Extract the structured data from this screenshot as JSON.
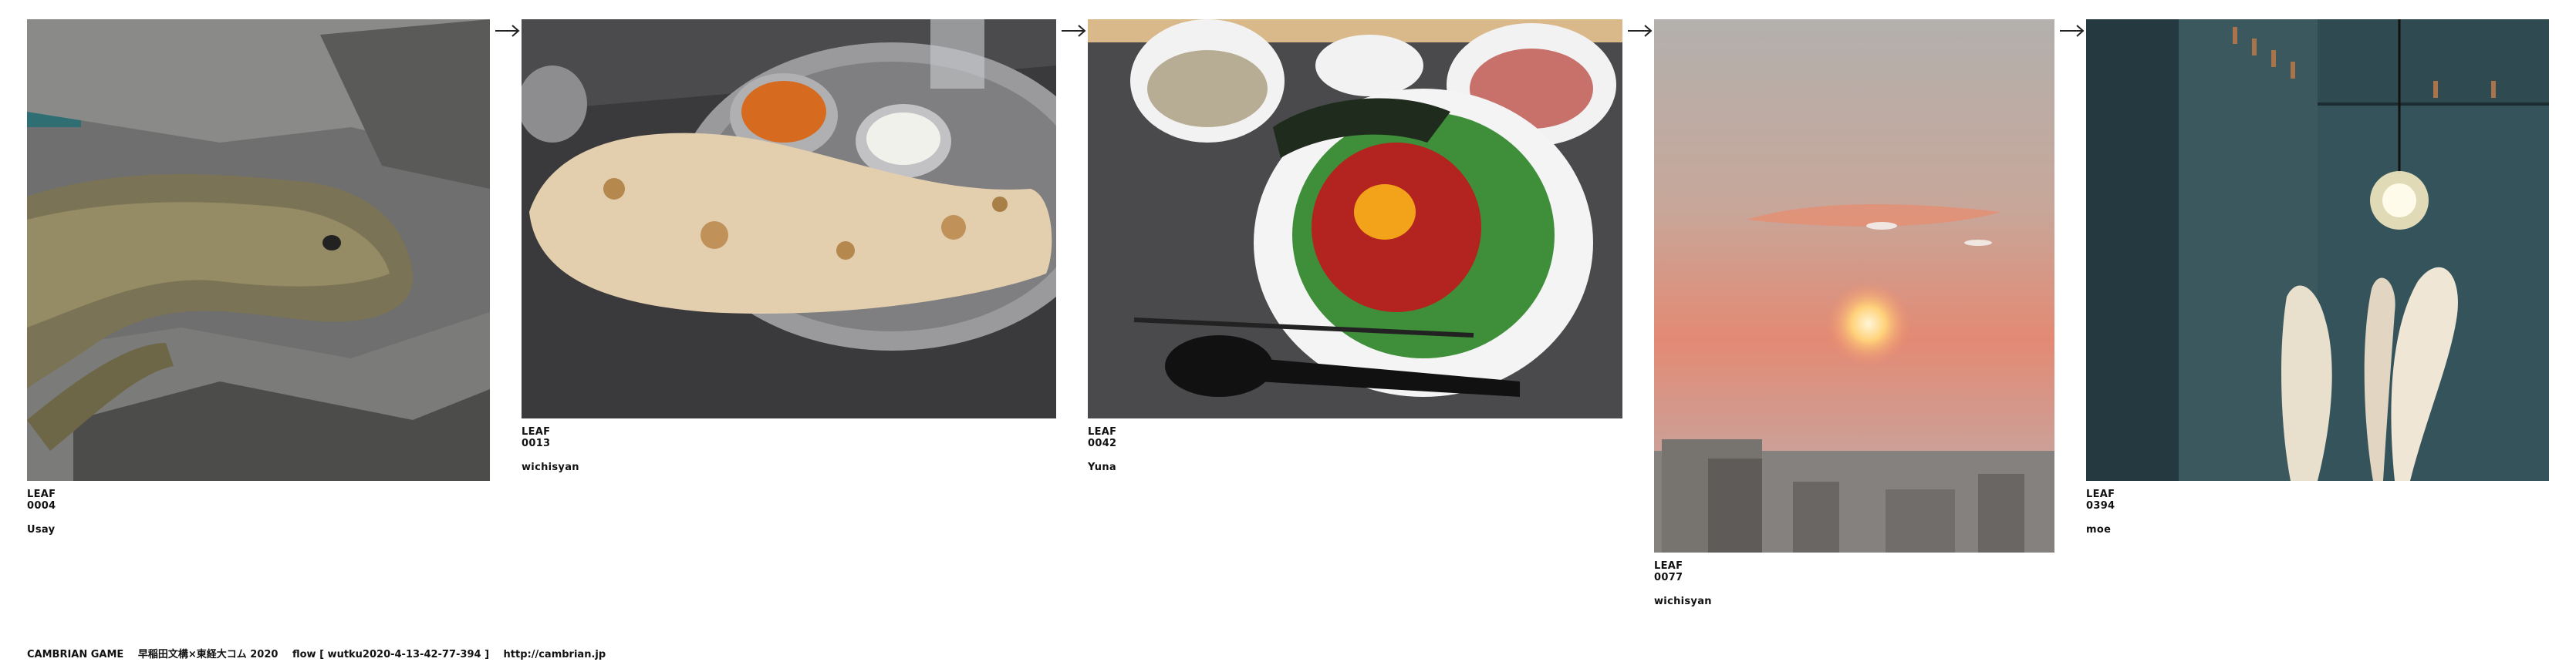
{
  "leaves": [
    {
      "code": "LEAF 0004",
      "author": "Usay",
      "image": "lizard on rocks"
    },
    {
      "code": "LEAF 0013",
      "author": "wichisyan",
      "image": "naan with curry plate"
    },
    {
      "code": "LEAF 0042",
      "author": "Yuna",
      "image": "yukhoe rice bowl tray"
    },
    {
      "code": "LEAF 0077",
      "author": "wichisyan",
      "image": "sunset over city"
    },
    {
      "code": "LEAF 0394",
      "author": "moe",
      "image": "pampas grass under lamp"
    }
  ],
  "footer": {
    "title": "CAMBRIAN GAME",
    "subtitle": "早稲田文構×東経大コム 2020",
    "flow": "flow [ wutku2020-4-13-42-77-394 ]",
    "url": "http://cambrian.jp"
  },
  "colors": {
    "text": "#111111",
    "background": "#ffffff"
  },
  "icons": {
    "connector": "right-arrow-icon"
  }
}
